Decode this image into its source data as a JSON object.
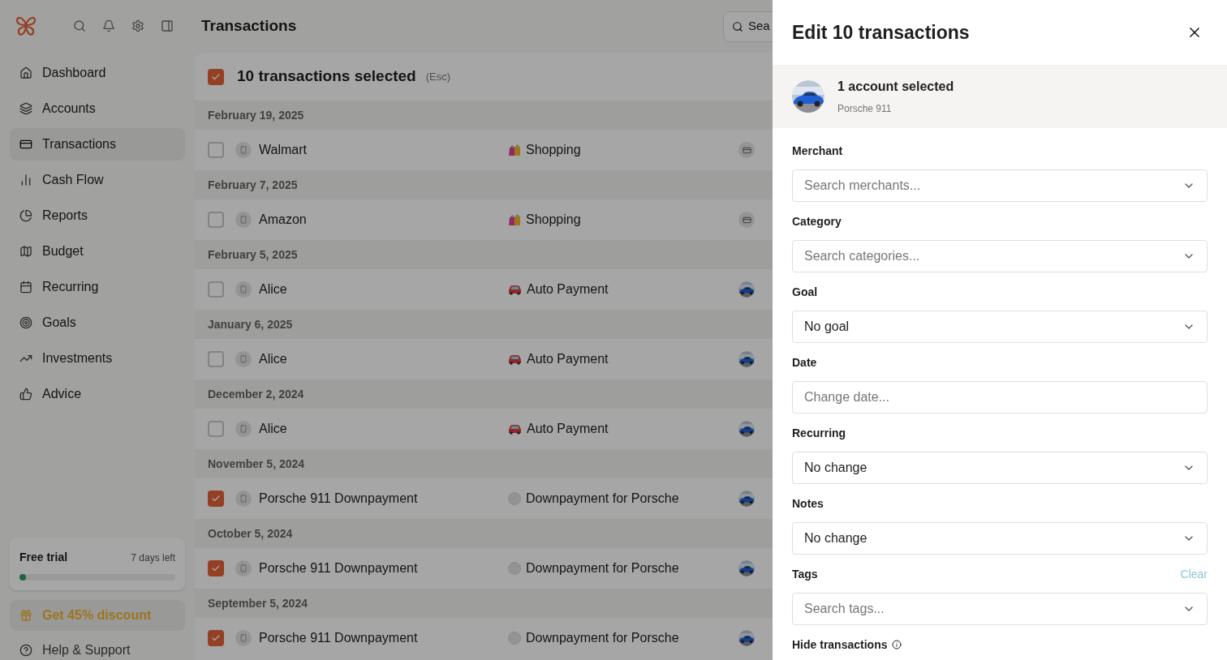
{
  "sidebar": {
    "items": [
      {
        "label": "Dashboard",
        "selected": false
      },
      {
        "label": "Accounts",
        "selected": false
      },
      {
        "label": "Transactions",
        "selected": true
      },
      {
        "label": "Cash Flow",
        "selected": false
      },
      {
        "label": "Reports",
        "selected": false
      },
      {
        "label": "Budget",
        "selected": false
      },
      {
        "label": "Recurring",
        "selected": false
      },
      {
        "label": "Goals",
        "selected": false
      },
      {
        "label": "Investments",
        "selected": false
      },
      {
        "label": "Advice",
        "selected": false
      }
    ],
    "trial": {
      "title": "Free trial",
      "remaining": "7 days left",
      "level": 0.03
    },
    "discount": "Get 45% discount",
    "help": "Help & Support"
  },
  "page_title": "Transactions",
  "search": {
    "placeholder": "Sea"
  },
  "selection": {
    "label": "10 transactions selected",
    "hint": "(Esc)",
    "checked": true
  },
  "groups": [
    {
      "date": "February 19, 2025",
      "kind": "shopping",
      "merchant": "Walmart",
      "category": "Shopping",
      "checked": false
    },
    {
      "date": "February 7, 2025",
      "kind": "shopping",
      "merchant": "Amazon",
      "category": "Shopping",
      "checked": false
    },
    {
      "date": "February 5, 2025",
      "kind": "auto",
      "merchant": "Alice",
      "category": "Auto Payment",
      "checked": false
    },
    {
      "date": "January 6, 2025",
      "kind": "auto",
      "merchant": "Alice",
      "category": "Auto Payment",
      "checked": false
    },
    {
      "date": "December 2, 2024",
      "kind": "auto",
      "merchant": "Alice",
      "category": "Auto Payment",
      "checked": false
    },
    {
      "date": "November 5, 2024",
      "kind": "downpayment",
      "merchant": "Porsche 911 Downpayment",
      "category": "Downpayment for Porsche",
      "checked": true
    },
    {
      "date": "October 5, 2024",
      "kind": "downpayment",
      "merchant": "Porsche 911 Downpayment",
      "category": "Downpayment for Porsche",
      "checked": true
    },
    {
      "date": "September 5, 2024",
      "kind": "downpayment",
      "merchant": "Porsche 911 Downpayment",
      "category": "Downpayment for Porsche",
      "checked": true
    }
  ],
  "drawer": {
    "title": "Edit 10 transactions",
    "account": {
      "title": "1 account selected",
      "name": "Porsche 911"
    },
    "fields": [
      {
        "label": "Merchant",
        "kind": "select",
        "placeholder": "Search merchants..."
      },
      {
        "label": "Category",
        "kind": "select",
        "placeholder": "Search categories..."
      },
      {
        "label": "Goal",
        "kind": "select",
        "value": "No goal"
      },
      {
        "label": "Date",
        "kind": "input",
        "placeholder": "Change date..."
      },
      {
        "label": "Recurring",
        "kind": "select",
        "value": "No change"
      },
      {
        "label": "Notes",
        "kind": "select",
        "value": "No change"
      },
      {
        "label": "Tags",
        "kind": "select",
        "placeholder": "Search tags...",
        "action": "Clear"
      }
    ],
    "last_label": "Hide transactions"
  }
}
